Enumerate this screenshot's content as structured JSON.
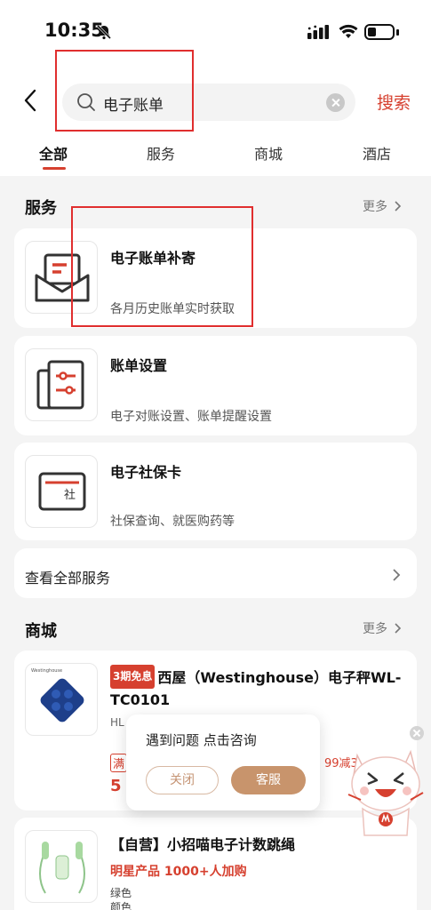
{
  "status_bar": {
    "time": "10:35"
  },
  "search": {
    "query": "电子账单",
    "button_label": "搜索"
  },
  "tabs": [
    {
      "label": "全部",
      "active": true
    },
    {
      "label": "服务",
      "active": false
    },
    {
      "label": "商城",
      "active": false
    },
    {
      "label": "酒店",
      "active": false
    }
  ],
  "services": {
    "title": "服务",
    "more": "更多",
    "items": [
      {
        "title": "电子账单补寄",
        "desc": "各月历史账单实时获取",
        "icon": "envelope-bill-icon"
      },
      {
        "title": "账单设置",
        "desc": "电子对账设置、账单提醒设置",
        "icon": "bill-settings-icon"
      },
      {
        "title": "电子社保卡",
        "desc": "社保查询、就医购药等",
        "icon": "social-security-card-icon",
        "icon_text": "社"
      }
    ],
    "view_all": "查看全部服务"
  },
  "mall": {
    "title": "商城",
    "more": "更多",
    "products": [
      {
        "tag": "3期免息",
        "title": "西屋（Westinghouse）电子秤WL-TC0101",
        "sub": "HL",
        "brand": "Westinghouse",
        "price_peek": "5",
        "discount_peek": "满",
        "coupon_peek": "99减3"
      },
      {
        "title": "【自营】小招喵电子计数跳绳",
        "promo": "明星产品 1000+人加购",
        "color_label": "绿色",
        "color_field": "颜色"
      }
    ]
  },
  "popup": {
    "text": "遇到问题 点击咨询",
    "close_label": "关闭",
    "service_label": "客服"
  },
  "colors": {
    "accent": "#d6402f",
    "highlight_box": "#e02e2e",
    "popup_button": "#c8946c"
  }
}
